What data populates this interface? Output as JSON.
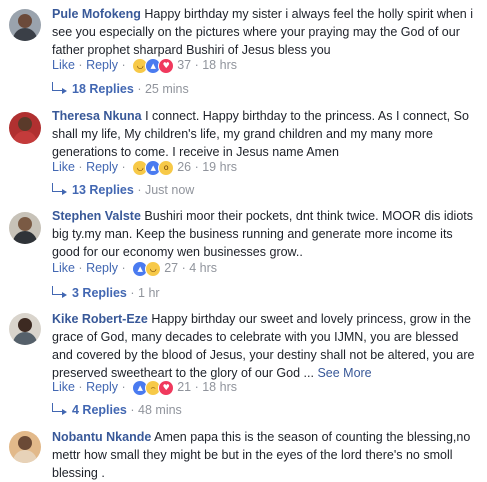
{
  "comments": [
    {
      "name": "Pule Mofokeng",
      "text": "Happy birthday my sister i always feel the holly spirit when i see you especially on the pictures where your praying may the God of our father prophet sharpard Bushiri of Jesus bless you",
      "like": "Like",
      "reply": "Reply",
      "reactions": [
        "haha-icon",
        "like-icon",
        "love-icon"
      ],
      "reaction_count": "37",
      "time": "18 hrs",
      "replies_label": "18 Replies",
      "replies_time": "25 mins"
    },
    {
      "name": "Theresa Nkuna",
      "text": "I connect. Happy birthday to the princess. As I connect, So shall my life, My children's life, my grand children and my many more generations to come. I receive in Jesus name Amen",
      "like": "Like",
      "reply": "Reply",
      "reactions": [
        "haha-icon",
        "like-icon",
        "wow-icon"
      ],
      "reaction_count": "26",
      "time": "19 hrs",
      "replies_label": "13 Replies",
      "replies_time": "Just now"
    },
    {
      "name": "Stephen Valste",
      "text": "Bushiri moor their pockets, dnt think twice. MOOR dis idiots big ty.my man. Keep the business running and generate more income its good for our economy wen businesses grow..",
      "like": "Like",
      "reply": "Reply",
      "reactions": [
        "like-icon",
        "haha-icon"
      ],
      "reaction_count": "27",
      "time": "4 hrs",
      "replies_label": "3 Replies",
      "replies_time": "1 hr"
    },
    {
      "name": "Kike Robert-Eze",
      "text": "Happy birthday our sweet and lovely princess, grow in the grace of God, many decades to celebrate with you IJMN, you are blessed and covered by the blood of Jesus, your destiny shall not be altered, you are preserved sweetheart to the glory of our God ...",
      "see_more": "See More",
      "like": "Like",
      "reply": "Reply",
      "reactions": [
        "like-icon",
        "sad-icon",
        "love-icon"
      ],
      "reaction_count": "21",
      "time": "18 hrs",
      "replies_label": "4 Replies",
      "replies_time": "48 mins"
    },
    {
      "name": "Nobantu Nkande",
      "text": "Amen papa this is the season of counting the blessing,no mettr how small they might be but in the eyes of the lord there's no smoll blessing ."
    }
  ],
  "separators": {
    "dot": "·"
  }
}
